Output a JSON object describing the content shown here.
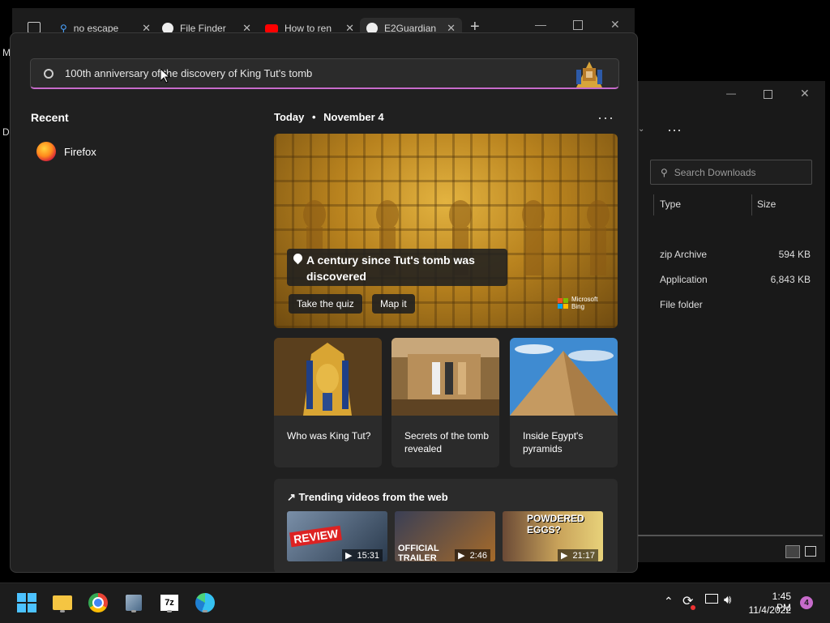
{
  "browser": {
    "tabs": [
      {
        "label": "no escape",
        "icon": "search-icon"
      },
      {
        "label": "File Finder",
        "icon": "github-icon"
      },
      {
        "label": "How to ren",
        "icon": "youtube-icon"
      },
      {
        "label": "E2Guardian",
        "icon": "github-icon"
      }
    ],
    "left_letters": [
      "M",
      "Da"
    ]
  },
  "explorer": {
    "search_placeholder": "Search Downloads",
    "columns": {
      "type": "Type",
      "size": "Size"
    },
    "rows": [
      {
        "type": "zip Archive",
        "size": "594 KB"
      },
      {
        "type": "Application",
        "size": "6,843 KB"
      },
      {
        "type": "File folder",
        "size": ""
      }
    ]
  },
  "search": {
    "query": "100th anniversary of the discovery of King Tut's tomb",
    "recent_title": "Recent",
    "recent_items": [
      {
        "label": "Firefox",
        "icon": "firefox-icon"
      }
    ],
    "today_label": "Today",
    "bullet": "•",
    "date_label": "November 4",
    "more_label": "···",
    "hero": {
      "caption": "A century since Tut's tomb was discovered",
      "buttons": [
        "Take the quiz",
        "Map it"
      ],
      "brand_line1": "Microsoft",
      "brand_line2": "Bing"
    },
    "cards": [
      {
        "title": "Who was King Tut?"
      },
      {
        "title": "Secrets of the tomb revealed"
      },
      {
        "title": "Inside Egypt's pyramids"
      }
    ],
    "trending_title": "Trending videos from the web",
    "videos": [
      {
        "label": "REVIEW",
        "duration": "15:31"
      },
      {
        "label": "OFFICIAL TRAILER",
        "duration": "2:46"
      },
      {
        "label": "POWDERED EGGS?",
        "duration": "21:17"
      }
    ]
  },
  "taskbar": {
    "apps": [
      "windows-start-icon",
      "file-explorer-icon",
      "chrome-icon",
      "network-app-icon",
      "7zip-icon",
      "edge-icon"
    ],
    "time": "1:45 PM",
    "date": "11/4/2022",
    "notification_count": "4"
  },
  "colors": {
    "accent": "#c76bcb",
    "panel": "#202020",
    "card": "#2b2b2b"
  }
}
